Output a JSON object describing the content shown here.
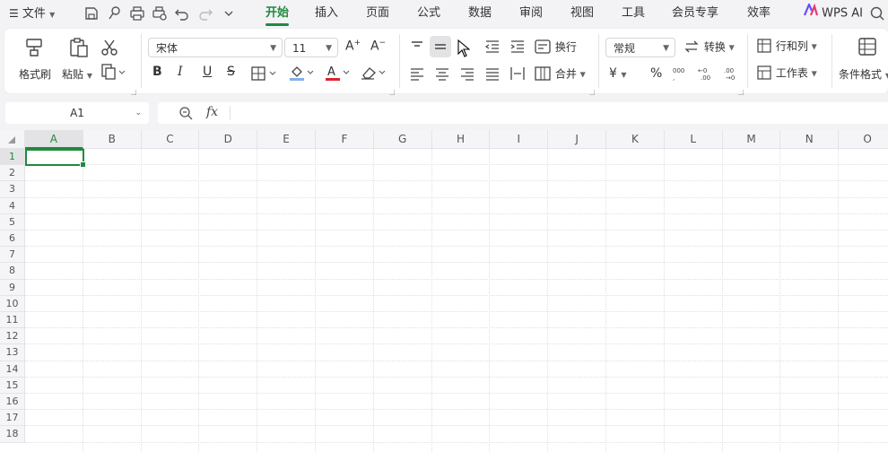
{
  "menubar": {
    "file_label": "文件",
    "tabs": [
      {
        "label": "开始",
        "active": true
      },
      {
        "label": "插入"
      },
      {
        "label": "页面"
      },
      {
        "label": "公式"
      },
      {
        "label": "数据"
      },
      {
        "label": "审阅"
      },
      {
        "label": "视图"
      },
      {
        "label": "工具"
      },
      {
        "label": "会员专享"
      },
      {
        "label": "效率"
      }
    ],
    "ai_label": "WPS AI",
    "accent_color": "#1f8a3c"
  },
  "ribbon": {
    "format_painter": "格式刷",
    "paste": "粘贴",
    "font_name": "宋体",
    "font_size": "11",
    "wrap_text": "换行",
    "merge": "合并",
    "number_format": "常规",
    "convert": "转换",
    "rows_cols": "行和列",
    "worksheet": "工作表",
    "conditional_format": "条件格式",
    "bold": "B",
    "italic": "I",
    "underline": "U",
    "strike": "S",
    "currency": "¥",
    "percent": "%"
  },
  "formula_bar": {
    "name_box": "A1",
    "fx_label": "fx",
    "value": ""
  },
  "sheet": {
    "columns": [
      "A",
      "B",
      "C",
      "D",
      "E",
      "F",
      "G",
      "H",
      "I",
      "J",
      "K",
      "L",
      "M",
      "N",
      "O"
    ],
    "rows": [
      "1",
      "2",
      "3",
      "4",
      "5",
      "6",
      "7",
      "8",
      "9",
      "10",
      "11",
      "12",
      "13",
      "14",
      "15",
      "16",
      "17",
      "18"
    ],
    "selected_cell": "A1"
  }
}
